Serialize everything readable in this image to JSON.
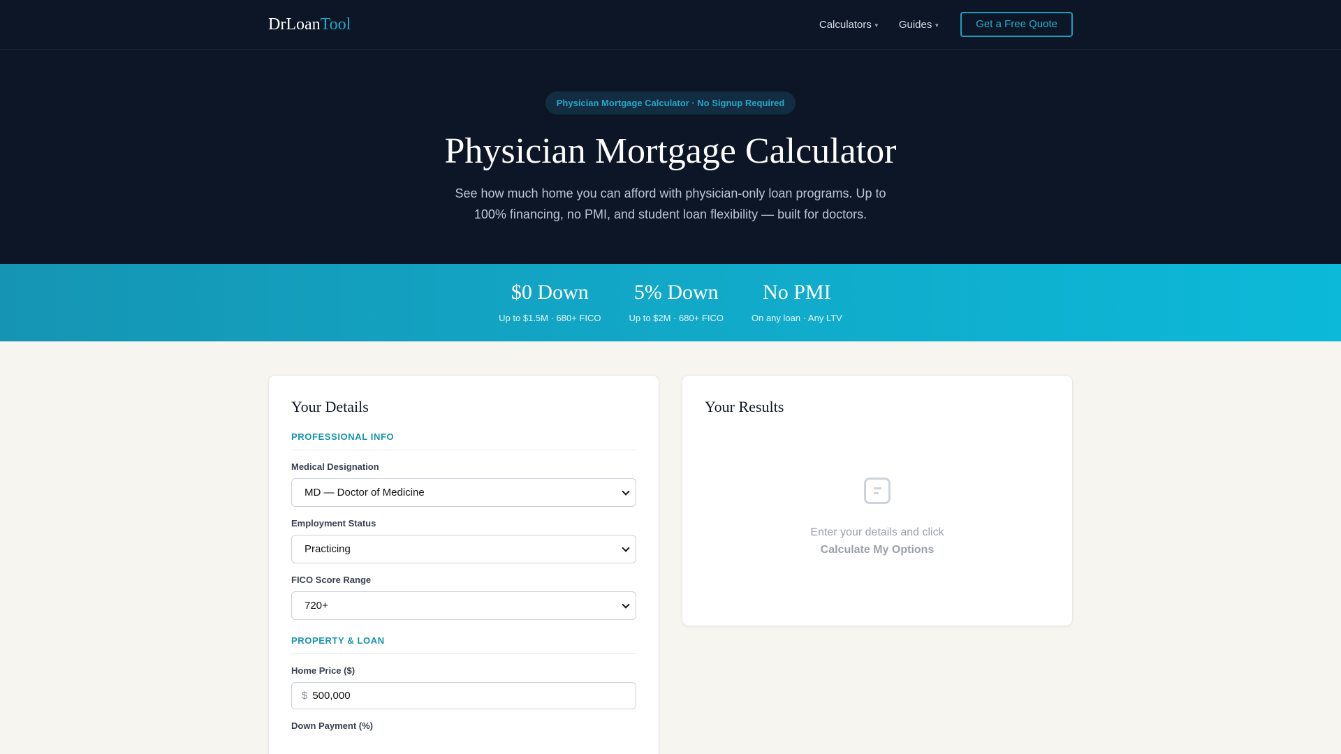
{
  "nav": {
    "logo_main": "DrLoan",
    "logo_accent": "Tool",
    "links": [
      {
        "label": "Calculators"
      },
      {
        "label": "Guides"
      }
    ],
    "cta": "Get a Free Quote"
  },
  "hero": {
    "badge": "Physician Mortgage Calculator · No Signup Required",
    "title": "Physician Mortgage Calculator",
    "subtitle": "See how much home you can afford with physician-only loan programs. Up to 100% financing, no PMI, and student loan flexibility — built for doctors."
  },
  "stats": [
    {
      "title": "$0 Down",
      "sub": "Up to $1.5M · 680+ FICO"
    },
    {
      "title": "5% Down",
      "sub": "Up to $2M · 680+ FICO"
    },
    {
      "title": "No PMI",
      "sub": "On any loan · Any LTV"
    }
  ],
  "details": {
    "title": "Your Details",
    "section_professional": "PROFESSIONAL INFO",
    "designation_label": "Medical Designation",
    "designation_value": "MD — Doctor of Medicine",
    "employment_label": "Employment Status",
    "employment_value": "Practicing",
    "fico_label": "FICO Score Range",
    "fico_value": "720+",
    "section_property": "PROPERTY & LOAN",
    "price_label": "Home Price ($)",
    "price_prefix": "$",
    "price_value": "500,000",
    "down_label": "Down Payment (%)"
  },
  "results": {
    "title": "Your Results",
    "empty_text": "Enter your details and click",
    "empty_action": "Calculate My Options"
  },
  "colors": {
    "nav_bg": "#0d1627",
    "accent": "#1692b1",
    "strip_start": "#1595b3",
    "strip_end": "#0cb9d8"
  }
}
